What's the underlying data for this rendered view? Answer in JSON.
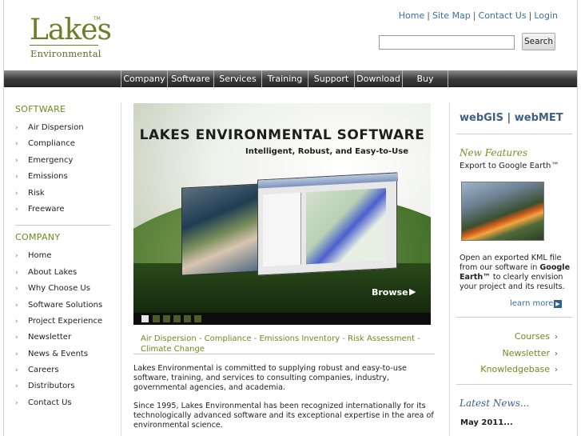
{
  "logo": {
    "name": "Lakes",
    "sub": "Environmental",
    "tm": "TM"
  },
  "toplinks": [
    {
      "label": "Home"
    },
    {
      "label": "Site Map"
    },
    {
      "label": "Contact Us"
    },
    {
      "label": "Login"
    }
  ],
  "search": {
    "button": "Search",
    "value": ""
  },
  "nav": [
    "Company",
    "Software",
    "Services",
    "Training",
    "Support",
    "Download",
    "Buy"
  ],
  "sidebar": {
    "software_head": "SOFTWARE",
    "software": [
      "Air Dispersion",
      "Compliance",
      "Emergency",
      "Emissions",
      "Risk",
      "Freeware"
    ],
    "company_head": "COMPANY",
    "company": [
      "Home",
      "About Lakes",
      "Why Choose Us",
      "Software Solutions",
      "Project Experience",
      "Newsletter",
      "News & Events",
      "Careers",
      "Distributors",
      "Contact Us"
    ]
  },
  "hero": {
    "title": "LAKES ENVIRONMENTAL SOFTWARE",
    "subtitle": "Intelligent, Robust, and Easy-to-Use",
    "browse": "Browse"
  },
  "slides": {
    "count": 6,
    "active": 0
  },
  "tags": [
    "Air Dispersion",
    "Compliance",
    "Emissions Inventory",
    "Risk Assessment",
    "Climate Change"
  ],
  "tag_sep": " - ",
  "main": {
    "p1": "Lakes Environmental is committed to supplying robust and easy-to-use software, training, and services to consulting companies, industry, governmental agencies, and academia.",
    "p2": "Since 1995, Lakes Environmental has been recognized internationally for its technologically advanced software and its exceptional expertise in the area of environmental science."
  },
  "right": {
    "title": "webGIS | webMET",
    "new_features": "New Features",
    "export": "Export to Google Earth™",
    "desc_a": "Open an exported KML file from our software in ",
    "desc_b": "Google Earth™",
    "desc_c": " to clearly envision your project and its results.",
    "learn_more": "learn more",
    "links": [
      "Courses",
      "Newsletter",
      "Knowledgebase"
    ],
    "latest": "Latest News...",
    "date": "May 2011..."
  }
}
